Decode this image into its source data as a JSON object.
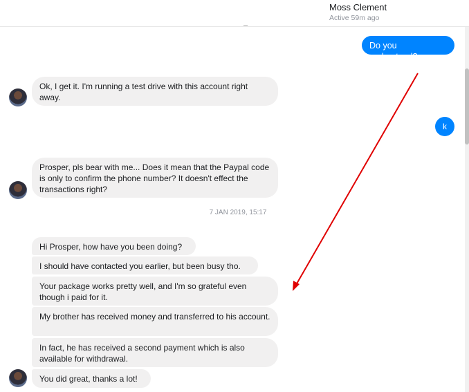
{
  "header": {
    "contact_name": "Moss Clement",
    "contact_status": "Active 59m ago"
  },
  "messages": [
    {
      "text": "Do you understand?"
    },
    {
      "text": "Ok, I get it. I'm running a test drive with this account right away."
    },
    {
      "text": "k"
    },
    {
      "text": "Prosper, pls bear with me... Does it mean that the Paypal code is only to confirm the phone number? It doesn't effect the transactions right?"
    },
    {
      "text": "Hi Prosper, how have you been doing?"
    },
    {
      "text": "I should have contacted you earlier, but been busy tho."
    },
    {
      "text": "Your package works pretty well, and I'm so grateful even though i paid for it."
    },
    {
      "text": "My brother has received money and transferred to his account."
    },
    {
      "text": "In fact, he has received a second payment which is also available for withdrawal."
    },
    {
      "text": "You did great, thanks a lot!"
    }
  ],
  "timestamp": "7 JAN 2019, 15:17",
  "colors": {
    "outgoing_bubble": "#0084ff",
    "incoming_bubble": "#f1f0f0",
    "annotation_arrow": "#e00000"
  },
  "icons": {
    "avatar": "avatar-photo",
    "annotation": "red-arrow-icon"
  }
}
